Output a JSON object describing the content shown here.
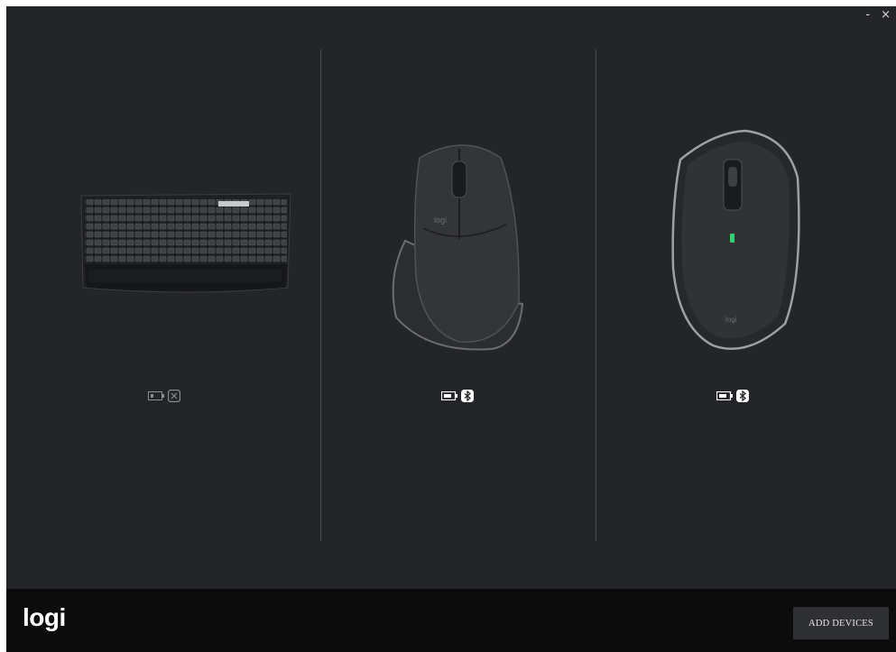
{
  "window": {
    "minimize_glyph": "-",
    "close_glyph": "×"
  },
  "devices": [
    {
      "kind": "keyboard",
      "battery_icon": "battery-icon",
      "connection_icon": "unifying-receiver-icon"
    },
    {
      "kind": "mouse",
      "battery_icon": "battery-icon",
      "connection_icon": "bluetooth-icon"
    },
    {
      "kind": "mouse",
      "battery_icon": "battery-icon",
      "connection_icon": "bluetooth-icon"
    }
  ],
  "footer": {
    "logo_text": "logi",
    "add_devices_label": "ADD DEVICES"
  },
  "colors": {
    "background": "#232528",
    "footer": "#0c0c0d",
    "indicator_green": "#2fd36b"
  }
}
